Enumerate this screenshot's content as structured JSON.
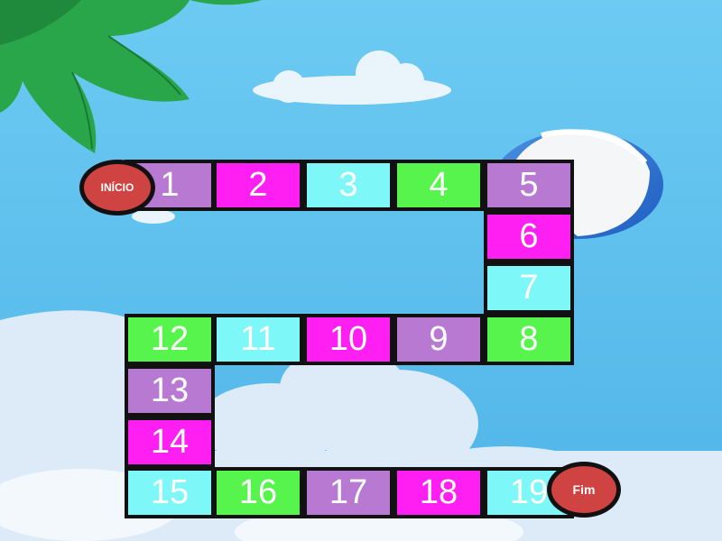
{
  "colors": {
    "sky": "#5ec2ee",
    "cloud": "#dcebf7",
    "leaf": "#2aa64a",
    "cell_purple": "#b879d3",
    "cell_magenta": "#ff1ff2",
    "cell_cyan": "#7df7f7",
    "cell_green": "#58f44e",
    "marker": "#cf4343",
    "border": "#111111"
  },
  "board": {
    "start_label": "INÍCIO",
    "end_label": "Fim",
    "cells": [
      {
        "label": "1",
        "color": "#b879d3"
      },
      {
        "label": "2",
        "color": "#ff1ff2"
      },
      {
        "label": "3",
        "color": "#7df7f7"
      },
      {
        "label": "4",
        "color": "#58f44e"
      },
      {
        "label": "5",
        "color": "#b879d3"
      },
      {
        "label": "6",
        "color": "#ff1ff2"
      },
      {
        "label": "7",
        "color": "#7df7f7"
      },
      {
        "label": "8",
        "color": "#58f44e"
      },
      {
        "label": "9",
        "color": "#b879d3"
      },
      {
        "label": "10",
        "color": "#ff1ff2"
      },
      {
        "label": "11",
        "color": "#7df7f7"
      },
      {
        "label": "12",
        "color": "#58f44e"
      },
      {
        "label": "13",
        "color": "#b879d3"
      },
      {
        "label": "14",
        "color": "#ff1ff2"
      },
      {
        "label": "15",
        "color": "#7df7f7"
      },
      {
        "label": "16",
        "color": "#58f44e"
      },
      {
        "label": "17",
        "color": "#b879d3"
      },
      {
        "label": "18",
        "color": "#ff1ff2"
      },
      {
        "label": "19",
        "color": "#7df7f7"
      }
    ]
  }
}
